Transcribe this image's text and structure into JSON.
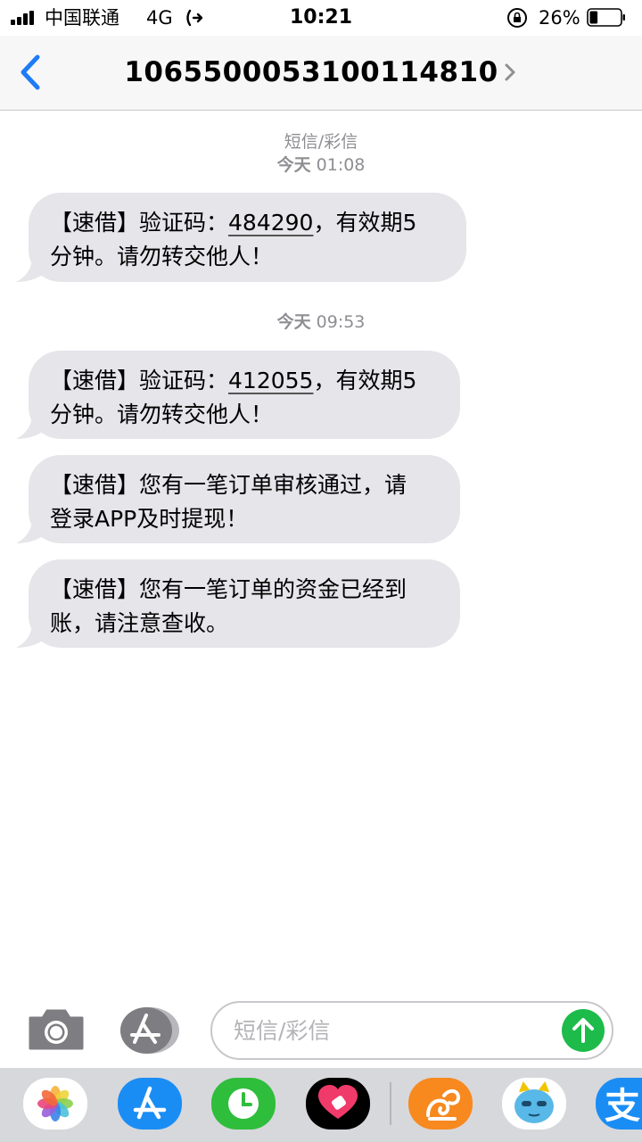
{
  "status_bar": {
    "carrier": "中国联通",
    "network": "4G",
    "time": "10:21",
    "battery_percent": "26%",
    "battery_level": 0.26
  },
  "nav": {
    "title": "1065500053100114810",
    "back_icon": "chevron-left-icon",
    "detail_icon": "chevron-right-icon"
  },
  "conversation": {
    "service_label": "短信/彩信",
    "groups": [
      {
        "timestamp_day": "今天",
        "timestamp_time": "01:08",
        "messages": [
          {
            "pre": "【速借】验证码：",
            "code": "484290",
            "line1_post": "，有效期5",
            "line2": "分钟。请勿转交他人！"
          }
        ]
      },
      {
        "timestamp_day": "今天",
        "timestamp_time": "09:53",
        "messages": [
          {
            "pre": "【速借】验证码：",
            "code": "412055",
            "line1_post": "，有效期5",
            "line2": "分钟。请勿转交他人！"
          },
          {
            "line1": "【速借】您有一笔订单审核通过，请",
            "line2": "登录APP及时提现！"
          },
          {
            "line1": "【速借】您有一笔订单的资金已经到",
            "line2": "账，请注意查收。"
          }
        ]
      }
    ]
  },
  "input_bar": {
    "placeholder": "短信/彩信",
    "camera_icon": "camera-icon",
    "appstore_icon": "app-store-icon",
    "send_icon": "send-arrow-icon"
  },
  "app_drawer": {
    "apps": [
      "photos-icon",
      "app-store-icon",
      "digital-touch-icon",
      "heartbeat-icon",
      "uc-browser-icon",
      "sticker-app-icon",
      "alipay-icon"
    ]
  },
  "colors": {
    "accent": "#1e7cf6",
    "bubble": "#e5e5ea",
    "send": "#1dbb4a",
    "timestamp": "#8e8e93"
  }
}
